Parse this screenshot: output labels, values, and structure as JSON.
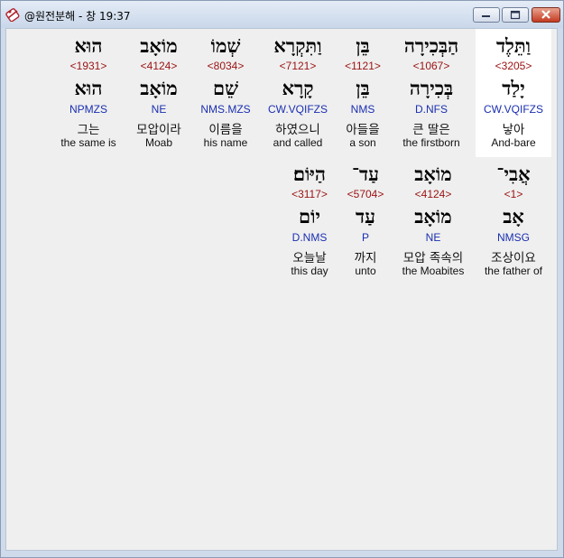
{
  "window": {
    "title": "@원전분해 - 창 19:37",
    "icons": {
      "app": "app-logo-icon",
      "minimize": "minimize-icon",
      "maximize": "maximize-icon",
      "close": "close-icon"
    }
  },
  "verse_rows": [
    {
      "words": [
        {
          "hebrew": "וַתֵּלֶד",
          "strong": "<3205>",
          "lemma": "יָלַד",
          "parse": "CW.VQIFZS",
          "korean": "낳아",
          "english": "And-bare",
          "selected": true
        },
        {
          "hebrew": "הַבְּכִירָה",
          "strong": "<1067>",
          "lemma": "בְּכִירָה",
          "parse": "D.NFS",
          "korean": "큰 딸은",
          "english": "the firstborn",
          "selected": false
        },
        {
          "hebrew": "בֵּן",
          "strong": "<1121>",
          "lemma": "בֵּן",
          "parse": "NMS",
          "korean": "아들을",
          "english": "a son",
          "selected": false
        },
        {
          "hebrew": "וַתִּקְרָא",
          "strong": "<7121>",
          "lemma": "קָרָא",
          "parse": "CW.VQIFZS",
          "korean": "하였으니",
          "english": "and called",
          "selected": false
        },
        {
          "hebrew": "שְׁמוֹ",
          "strong": "<8034>",
          "lemma": "שֵׁם",
          "parse": "NMS.MZS",
          "korean": "이름을",
          "english": "his name",
          "selected": false
        },
        {
          "hebrew": "מוֹאָב",
          "strong": "<4124>",
          "lemma": "מוֹאָב",
          "parse": "NE",
          "korean": "모압이라",
          "english": "Moab",
          "selected": false
        },
        {
          "hebrew": "הוּא",
          "strong": "<1931>",
          "lemma": "הוּא",
          "parse": "NPMZS",
          "korean": "그는",
          "english": "the same is",
          "selected": false
        }
      ]
    },
    {
      "words": [
        {
          "hebrew": "אֲבִי־",
          "strong": "<1>",
          "lemma": "אָב",
          "parse": "NMSG",
          "korean": "조상이요",
          "english": "the father of",
          "selected": false
        },
        {
          "hebrew": "מוֹאָב",
          "strong": "<4124>",
          "lemma": "מוֹאָב",
          "parse": "NE",
          "korean": "모압 족속의",
          "english": "the Moabites",
          "selected": false
        },
        {
          "hebrew": "עַד־",
          "strong": "<5704>",
          "lemma": "עַד",
          "parse": "P",
          "korean": "까지",
          "english": "unto",
          "selected": false
        },
        {
          "hebrew": "הַיּוֹם׃",
          "strong": "<3117>",
          "lemma": "יוֹם",
          "parse": "D.NMS",
          "korean": "오늘날",
          "english": "this day",
          "selected": false
        }
      ]
    }
  ]
}
